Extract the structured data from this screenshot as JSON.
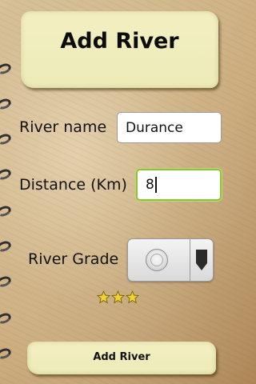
{
  "header": {
    "title": "Add River"
  },
  "form": {
    "river_name": {
      "label": "River name",
      "value": "Durance"
    },
    "distance": {
      "label": "Distance (Km)",
      "value": "8"
    },
    "river_grade": {
      "label": "River Grade",
      "stars": 3
    }
  },
  "actions": {
    "submit_label": "Add River"
  },
  "colors": {
    "note_paper": "#f3efc2",
    "focus_border": "#8fc23a",
    "star_fill": "#f2d22e"
  },
  "icons": {
    "spinner_arrow": "dropdown-arrow-icon",
    "radio": "radio-button-icon",
    "star": "star-icon",
    "ring": "spiral-ring-icon"
  }
}
